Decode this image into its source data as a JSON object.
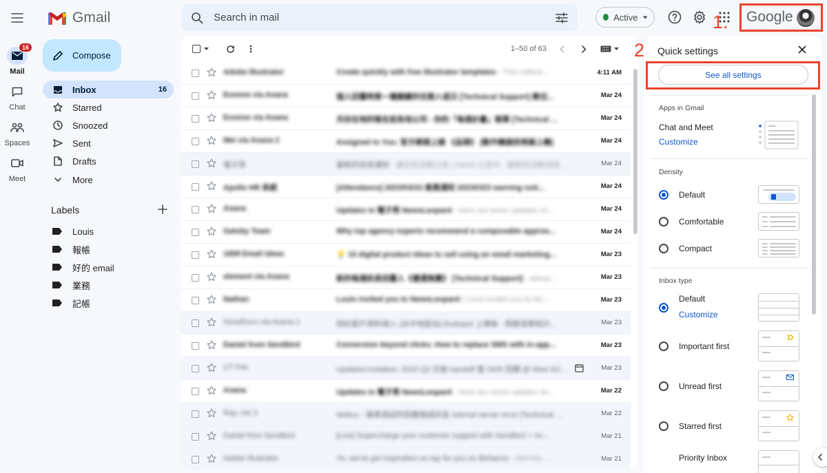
{
  "header": {
    "app_name": "Gmail",
    "search_placeholder": "Search in mail",
    "status_label": "Active",
    "account_brand": "Google",
    "annotations": [
      "1.",
      "2."
    ]
  },
  "rail": [
    {
      "label": "Mail",
      "badge": "16",
      "icon": "mail-icon"
    },
    {
      "label": "Chat",
      "icon": "chat-icon"
    },
    {
      "label": "Spaces",
      "icon": "spaces-icon"
    },
    {
      "label": "Meet",
      "icon": "meet-icon"
    }
  ],
  "compose_label": "Compose",
  "nav": [
    {
      "label": "Inbox",
      "count": "16",
      "icon": "inbox-icon"
    },
    {
      "label": "Starred",
      "count": "",
      "icon": "star-icon"
    },
    {
      "label": "Snoozed",
      "count": "",
      "icon": "clock-icon"
    },
    {
      "label": "Sent",
      "count": "",
      "icon": "send-icon"
    },
    {
      "label": "Drafts",
      "count": "",
      "icon": "draft-icon"
    },
    {
      "label": "More",
      "count": "",
      "icon": "chevron-down-icon"
    }
  ],
  "labels": {
    "title": "Labels",
    "items": [
      "Louis",
      "報帳",
      "好的 email",
      "業務",
      "記帳"
    ]
  },
  "mail_list": {
    "pager": "1–50 of 63",
    "rows": [
      {
        "sender": "Adobe Illustrator",
        "subject": "Create quickly with free Illustrator templates",
        "preview": "- This collecti...",
        "date": "4:11 AM",
        "unread": true
      },
      {
        "sender": "Evonne via Asana",
        "subject": "個人回覆時第一種關鍵的任務入或日 [Technical Support] 數位...",
        "preview": "",
        "date": "Mar 24",
        "unread": true
      },
      {
        "sender": "Evonne via Asana",
        "subject": "月份在地的報名抵免地公司 - 你的「每週計畫」報單 [Technical ...",
        "preview": "",
        "date": "Mar 24",
        "unread": true
      },
      {
        "sender": "Mei via Asana 2",
        "subject": "Assigned to You: 官方帳號上線 《品碩》 [動作機器技術線上機]",
        "preview": "",
        "date": "Mar 24",
        "unread": true
      },
      {
        "sender": "電子秀",
        "subject": "最新的訊息通知",
        "preview": "- 最近的活動公告 | SAAS 公告中 - 最新的活動消息...",
        "date": "Mar 24",
        "unread": false
      },
      {
        "sender": "Apollo HR 系統",
        "subject": "[Attendance] 2023/03/23 差異通知 20230323 warning noti...",
        "preview": "",
        "date": "Mar 24",
        "unread": true
      },
      {
        "sender": "Asana",
        "subject": "Updates in 電子秀 NewsLeopard",
        "preview": "- Here are some updates on...",
        "date": "Mar 24",
        "unread": true
      },
      {
        "sender": "Gatsby Team",
        "subject": "Why top agency experts recommend a composable approa...",
        "preview": "",
        "date": "Mar 24",
        "unread": true
      },
      {
        "sender": "1808 Email ideas",
        "subject": "💡 15 digital product ideas to sell using an email marketing...",
        "preview": "",
        "date": "Mar 23",
        "unread": true
      },
      {
        "sender": "element via Asana",
        "subject": "新的每週訊息回覆人《優選推薦》 [Technical Support]",
        "preview": "- eleme...",
        "date": "Mar 23",
        "unread": true
      },
      {
        "sender": "Nathan",
        "subject": "Louis invited you to NewsLeopard",
        "preview": "| Louis invited you to Ne...",
        "date": "Mar 23",
        "unread": true
      },
      {
        "sender": "GoodGuru via Asana 2",
        "subject": "特約客戶資料填入 (台中地區站) [hubspot 上傳後 - 問題清單統計...",
        "preview": "",
        "date": "Mar 23",
        "unread": false
      },
      {
        "sender": "Daniel from Sendbird",
        "subject": "Conversion beyond clicks: How to replace SMS with in-app...",
        "preview": "",
        "date": "Mar 23",
        "unread": true
      },
      {
        "sender": "CT Firk",
        "subject": "Updated invitation: 2023 Q2 交接 handoff 會 OKR 回饋 @ Wed 3/2...",
        "preview": "",
        "date": "Mar 23",
        "unread": false,
        "calendar": true
      },
      {
        "sender": "Asana",
        "subject": "Updates in 電子秀 NewsLeopard",
        "preview": "- Here are some updates on...",
        "date": "Mar 22",
        "unread": true
      },
      {
        "sender": "Ray, me 3",
        "subject": "Webcc - 報表測試的回應錯誤訊息 internal server error [Technical ...",
        "preview": "",
        "date": "Mar 22",
        "unread": false
      },
      {
        "sender": "Daniel from Sendbird",
        "subject": "[Live] Supercharge your customer support with Sendbird + no...",
        "preview": "",
        "date": "Mar 21",
        "unread": false
      },
      {
        "sender": "Adobe Illustrator",
        "subject": "Yo, we've got inspiration on tap for you on Behance",
        "preview": "- Hermés -...",
        "date": "Mar 21",
        "unread": false
      }
    ]
  },
  "quick_settings": {
    "title": "Quick settings",
    "see_all": "See all settings",
    "apps_title": "Apps in Gmail",
    "chat_meet": "Chat and Meet",
    "customize": "Customize",
    "density_title": "Density",
    "density_options": [
      {
        "label": "Default",
        "selected": true
      },
      {
        "label": "Comfortable",
        "selected": false
      },
      {
        "label": "Compact",
        "selected": false
      }
    ],
    "inbox_title": "Inbox type",
    "inbox_options": [
      {
        "label": "Default",
        "selected": true
      },
      {
        "label": "Important first",
        "selected": false
      },
      {
        "label": "Unread first",
        "selected": false
      },
      {
        "label": "Starred first",
        "selected": false
      },
      {
        "label": "Priority Inbox",
        "selected": false
      }
    ]
  },
  "colors": {
    "accent": "#0b57d0",
    "annotation": "#e8432a",
    "active_nav": "#d3e3fd",
    "compose": "#c2e7ff"
  }
}
